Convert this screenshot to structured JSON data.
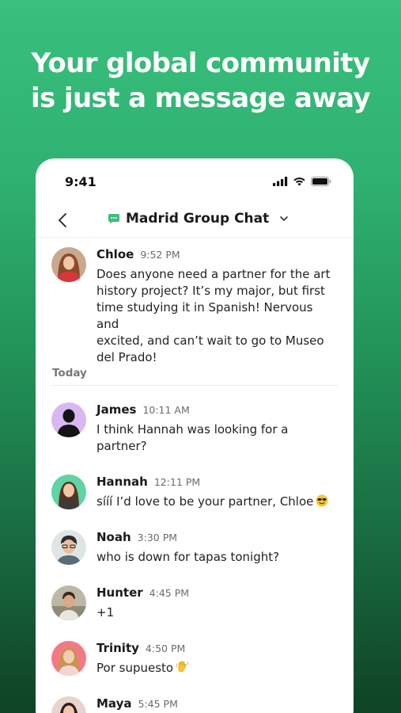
{
  "headline": {
    "line1": "Your global community",
    "line2": "is just a message away"
  },
  "status_bar": {
    "time": "9:41"
  },
  "nav": {
    "title": "Madrid Group Chat"
  },
  "divider": {
    "label": "Today"
  },
  "messages": [
    {
      "name": "Chloe",
      "time": "9:52 PM",
      "text": "Does anyone need a partner for the art\nhistory project? It’s my major, but first\ntime studying it in Spanish! Nervous and\nexcited, and can’t wait to go to Museo\ndel Prado!"
    },
    {
      "name": "James",
      "time": "10:11 AM",
      "text": "I think Hannah was looking for a\npartner?"
    },
    {
      "name": "Hannah",
      "time": "12:11 PM",
      "text": "sííí I’d love to be your partner, Chloe"
    },
    {
      "name": "Noah",
      "time": "3:30 PM",
      "text": "who is down for tapas tonight?"
    },
    {
      "name": "Hunter",
      "time": "4:45 PM",
      "text": "+1"
    },
    {
      "name": "Trinity",
      "time": "4:50 PM",
      "text": "Por supuesto"
    },
    {
      "name": "Maya",
      "time": "5:45 PM",
      "text": ""
    }
  ],
  "icons": {
    "back": "chevron-left-icon",
    "chat": "chat-bubble-icon",
    "dropdown": "chevron-down-icon",
    "signal": "cellular-signal-icon",
    "wifi": "wifi-icon",
    "battery": "battery-icon",
    "sunglasses_emoji": "smiling-face-with-sunglasses-emoji",
    "wave_emoji": "waving-hand-emoji"
  },
  "colors": {
    "brand_green": "#2fb171",
    "chat_icon_green": "#3cbf7d"
  }
}
